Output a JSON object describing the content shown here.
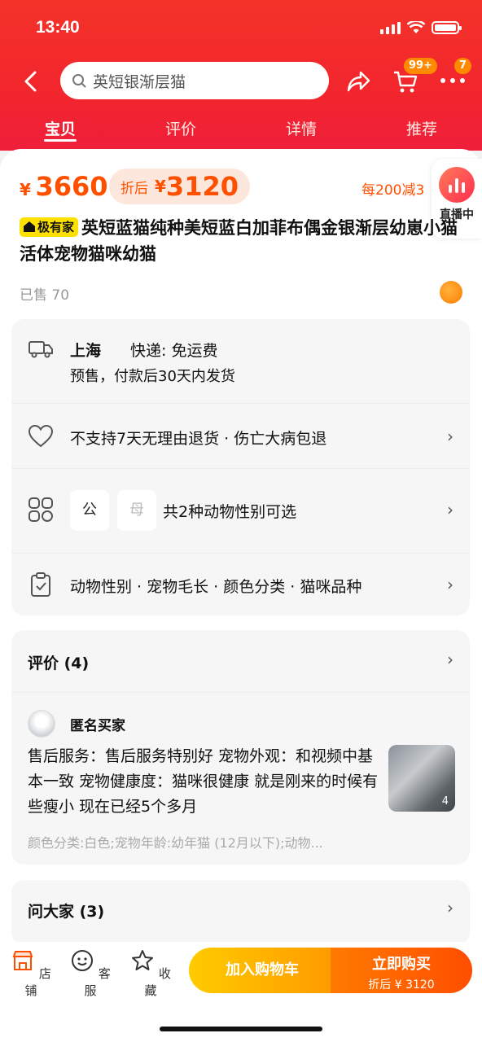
{
  "status_bar": {
    "time": "13:40"
  },
  "header": {
    "search_placeholder": "英短银渐层猫",
    "cart_badge": "99+",
    "more_badge": "7",
    "tabs": [
      "宝贝",
      "评价",
      "详情",
      "推荐"
    ]
  },
  "product": {
    "price_symbol": "¥",
    "price": "3660",
    "after_label": "折后",
    "after_price": "3120",
    "promo": "每200减3",
    "live_label": "直播中",
    "tag_label": "极有家",
    "title": "英短蓝猫纯种美短蓝白加菲布偶金银渐层幼崽小猫活体宠物猫咪幼猫",
    "sold": "已售 70"
  },
  "info": {
    "location": "上海",
    "shipping": "快递: 免运费",
    "presale": "预售，付款后30天内发货",
    "returns": "不支持7天无理由退货 · 伤亡大病包退",
    "gender_chips": [
      "公",
      "母"
    ],
    "gender_text": "共2种动物性别可选",
    "specs": "动物性别 · 宠物毛长 · 颜色分类 · 猫咪品种"
  },
  "reviews": {
    "header": "评价 (4)",
    "buyer": "匿名买家",
    "text": "售后服务：售后服务特别好 宠物外观：和视频中基本一致 宠物健康度：猫咪很健康 就是刚来的时候有些瘦小 现在已经5个多月",
    "image_count": "4",
    "meta": "颜色分类:白色;宠物年龄:幼年猫 (12月以下);动物..."
  },
  "qa": {
    "header": "问大家 (3)"
  },
  "bottom_bar": {
    "shop": "店铺",
    "service": "客服",
    "favorite": "收藏",
    "add_cart": "加入购物车",
    "buy_now": "立即购买",
    "buy_sub": "折后 ¥ 3120"
  },
  "colors": {
    "accent": "#ff5000",
    "header": "#f2262c"
  }
}
